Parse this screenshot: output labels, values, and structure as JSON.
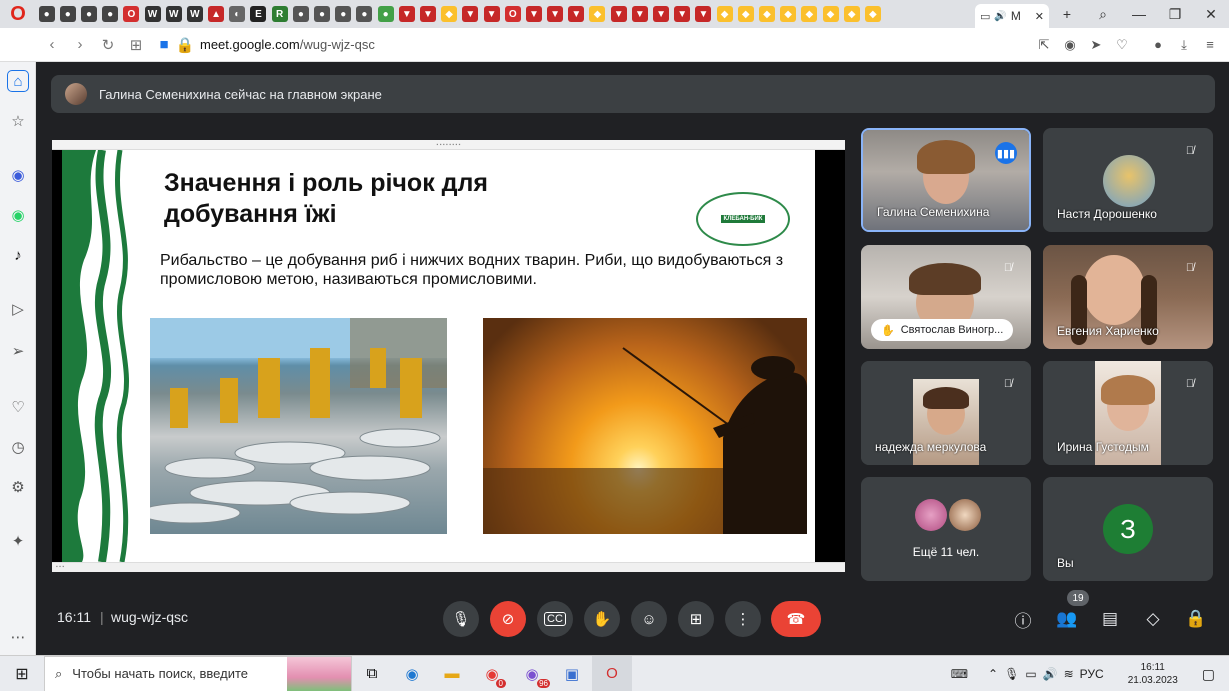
{
  "browser": {
    "active_tab_label": "M",
    "url_host": "meet.google.com",
    "url_path": "/wug-wjz-qsc",
    "new_tab": "+",
    "window_min": "—",
    "window_max": "❐",
    "window_close": "✕"
  },
  "meet": {
    "banner_text": "Галина Семенихина сейчас на главном экране",
    "participants": [
      {
        "name": "Галина Семенихина",
        "state": "speaking"
      },
      {
        "name": "Настя Дорошенко",
        "state": "muted"
      },
      {
        "name": "Святослав Виногр...",
        "state": "muted"
      },
      {
        "name": "Евгения Хариенко",
        "state": "muted"
      },
      {
        "name": "надежда меркулова",
        "state": "muted"
      },
      {
        "name": "Ирина Густодым",
        "state": "muted"
      }
    ],
    "others_label": "Ещё 11 чел.",
    "self_label": "Вы",
    "self_initial": "З",
    "participant_count": "19"
  },
  "slide": {
    "title": "Значення і роль річок для добування їжі",
    "body": "Рибальство – це добування риб і нижчих водних тварин. Риби, що видобуваються з промисловою метою, називаються промисловими.",
    "logo_text": "КЛЕБАН-БИК"
  },
  "controls": {
    "time": "16:11",
    "separator": "|",
    "meeting_code": "wug-wjz-qsc"
  },
  "taskbar": {
    "search_placeholder": "Чтобы начать поиск, введите",
    "language": "РУС",
    "time": "16:11",
    "date": "21.03.2023",
    "badge_yandex": "0",
    "badge_viber": "96"
  },
  "colors": {
    "meet_bg": "#202124",
    "tile_bg": "#3c4043",
    "hangup_red": "#ea4335",
    "speaking_blue": "#8ab4f8",
    "self_avatar_green": "#1e7e34"
  }
}
